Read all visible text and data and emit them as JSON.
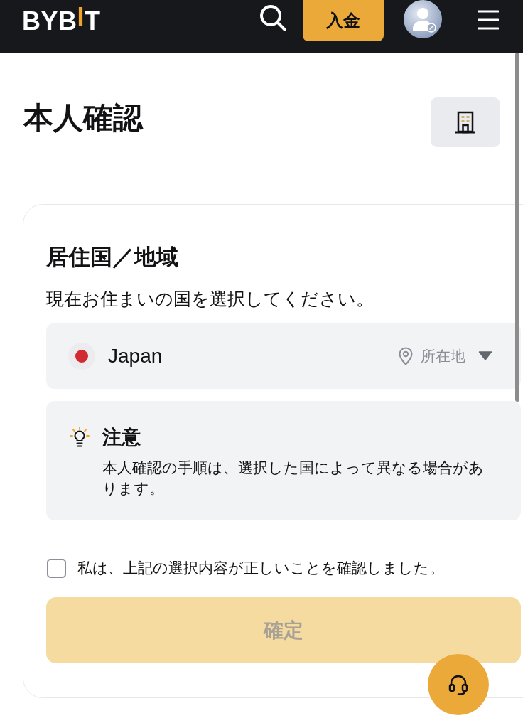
{
  "header": {
    "logo": "BYBIT",
    "deposit_button": {
      "label": "入金"
    }
  },
  "page_title": "本人確認",
  "residence_card": {
    "title": "居住国／地域",
    "subtitle": "現在お住まいの国を選択してください。",
    "country_select": {
      "value": "Japan",
      "location_label": "所在地"
    },
    "notice": {
      "title": "注意",
      "text": "本人確認の手順は、選択した国によって異なる場合があります。"
    },
    "confirmation_checkbox": {
      "label": "私は、上記の選択内容が正しいことを確認しました。",
      "checked": false
    },
    "confirm_button": {
      "label": "確定",
      "disabled": true
    }
  }
}
